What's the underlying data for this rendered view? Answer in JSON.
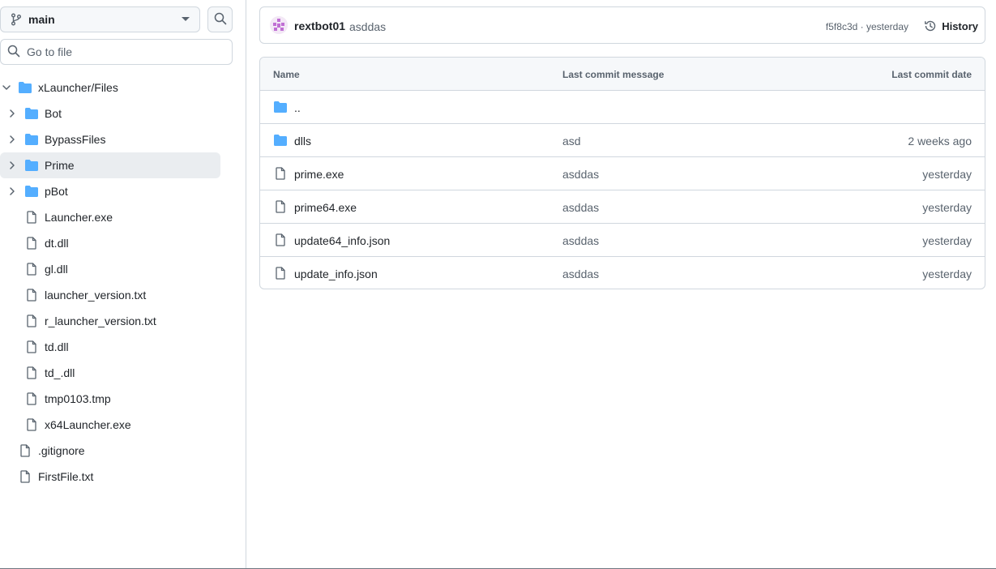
{
  "sidebar": {
    "branch": "main",
    "goto_placeholder": "Go to file",
    "tree": [
      {
        "label": "xLauncher/Files",
        "type": "folder",
        "level": 0,
        "chevron": "chevron-down",
        "active": false
      },
      {
        "label": "Bot",
        "type": "folder",
        "level": 1,
        "chevron": "chevron-right",
        "active": false
      },
      {
        "label": "BypassFiles",
        "type": "folder",
        "level": 1,
        "chevron": "chevron-right",
        "active": false
      },
      {
        "label": "Prime",
        "type": "folder",
        "level": 1,
        "chevron": "chevron-right",
        "active": true
      },
      {
        "label": "pBot",
        "type": "folder",
        "level": 1,
        "chevron": "chevron-right",
        "active": false
      },
      {
        "label": "Launcher.exe",
        "type": "file",
        "level": 1,
        "active": false
      },
      {
        "label": "dt.dll",
        "type": "file",
        "level": 1,
        "active": false
      },
      {
        "label": "gl.dll",
        "type": "file",
        "level": 1,
        "active": false
      },
      {
        "label": "launcher_version.txt",
        "type": "file",
        "level": 1,
        "active": false
      },
      {
        "label": "r_launcher_version.txt",
        "type": "file",
        "level": 1,
        "active": false
      },
      {
        "label": "td.dll",
        "type": "file",
        "level": 1,
        "active": false
      },
      {
        "label": "td_.dll",
        "type": "file",
        "level": 1,
        "active": false
      },
      {
        "label": "tmp0103.tmp",
        "type": "file",
        "level": 1,
        "active": false
      },
      {
        "label": "x64Launcher.exe",
        "type": "file",
        "level": 1,
        "active": false
      },
      {
        "label": ".gitignore",
        "type": "file",
        "level": 0,
        "active": false
      },
      {
        "label": "FirstFile.txt",
        "type": "file",
        "level": 0,
        "active": false
      }
    ]
  },
  "commit": {
    "author": "rextbot01",
    "message": "asddas",
    "sha": "f5f8c3d",
    "separator": " · ",
    "time": "yesterday",
    "history_label": "History"
  },
  "table": {
    "headers": {
      "name": "Name",
      "message": "Last commit message",
      "date": "Last commit date"
    },
    "rows": [
      {
        "name": "..",
        "type": "folder",
        "message": "",
        "date": ""
      },
      {
        "name": "dlls",
        "type": "folder",
        "message": "asd",
        "date": "2 weeks ago"
      },
      {
        "name": "prime.exe",
        "type": "file",
        "message": "asddas",
        "date": "yesterday"
      },
      {
        "name": "prime64.exe",
        "type": "file",
        "message": "asddas",
        "date": "yesterday"
      },
      {
        "name": "update64_info.json",
        "type": "file",
        "message": "asddas",
        "date": "yesterday"
      },
      {
        "name": "update_info.json",
        "type": "file",
        "message": "asddas",
        "date": "yesterday"
      }
    ]
  },
  "colors": {
    "folder": "#54aeff",
    "file_icon": "#59636e",
    "border": "#d0d7de",
    "active_row": "#eaedf0"
  }
}
